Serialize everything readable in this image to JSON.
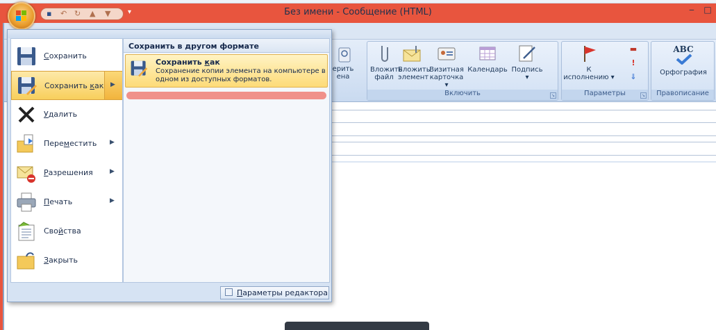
{
  "window": {
    "title": "Без имени - Сообщение (HTML)",
    "minimize": "‒",
    "restore": "□"
  },
  "ribbon": {
    "groups": {
      "include": {
        "label": "Включить"
      },
      "options": {
        "label": "Параметры"
      },
      "proofing": {
        "label": "Правописание"
      }
    },
    "buttons": {
      "check_names_top": "ерить",
      "check_names_bottom": "ена",
      "attach_file_top": "Вложить",
      "attach_file_bottom": "файл",
      "attach_item_top": "Вложить",
      "attach_item_bottom": "элемент",
      "business_card_top": "Визитная",
      "business_card_bottom": "карточка ▾",
      "calendar": "Календарь",
      "signature_top": "Подпись",
      "signature_bottom": "▾",
      "followup_top": "К",
      "followup_bottom": "исполнению ▾",
      "spelling_top": "ABC",
      "spelling": "Орфография"
    }
  },
  "app_menu": {
    "items": [
      {
        "label": "Сохранить",
        "u": "С",
        "rest": "охранить"
      },
      {
        "label": "Сохранить как",
        "pre": "Сохранить ",
        "u": "к",
        "rest": "ак"
      },
      {
        "label": "Удалить",
        "u": "У",
        "rest": "далить"
      },
      {
        "label": "Переместить",
        "pre": "Пере",
        "u": "м",
        "rest": "естить"
      },
      {
        "label": "Разрешения",
        "u": "Р",
        "rest": "азрешения"
      },
      {
        "label": "Печать",
        "u": "П",
        "rest": "ечать"
      },
      {
        "label": "Свойства",
        "pre": "Сво",
        "u": "й",
        "rest": "ства"
      },
      {
        "label": "Закрыть",
        "u": "З",
        "rest": "акрыть"
      }
    ],
    "submenu": {
      "header": "Сохранить в другом формате",
      "item_title_pre": "Сохранить ",
      "item_title_u": "к",
      "item_title_rest": "ак",
      "item_desc": "Сохранение копии элемента на компьютере в одном из доступных форматов."
    },
    "editor_options_u": "П",
    "editor_options_rest": "араметры редактора"
  },
  "colors": {
    "titlebar": "#e8553e",
    "ribbon": "#dbe6f4",
    "highlight": "#fddb78"
  }
}
